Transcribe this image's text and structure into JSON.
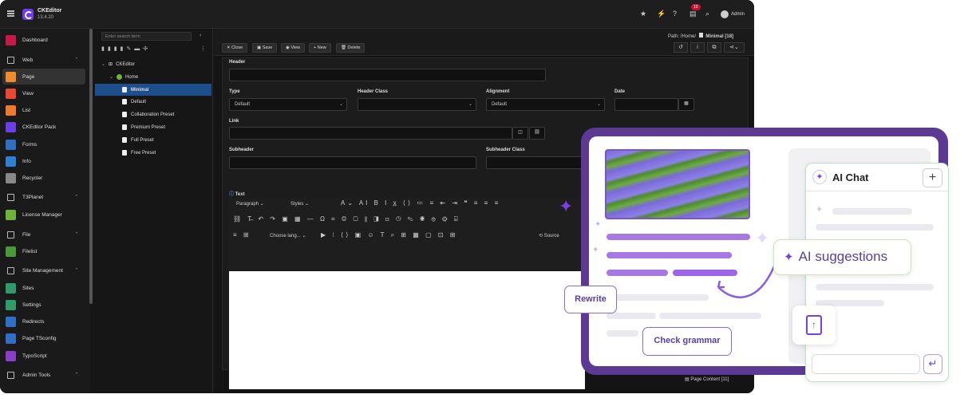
{
  "app": {
    "name": "CKEditor",
    "version": "13.4.20"
  },
  "topbar": {
    "notification_count": "10",
    "user_name": "Admin"
  },
  "module_menu": [
    {
      "label": "Dashboard",
      "color": "#c8174a",
      "type": "item"
    },
    {
      "label": "Web",
      "type": "group"
    },
    {
      "label": "Page",
      "color": "#f08c2c",
      "type": "item",
      "active": true
    },
    {
      "label": "View",
      "color": "#e84834",
      "type": "item"
    },
    {
      "label": "List",
      "color": "#f07a2c",
      "type": "item"
    },
    {
      "label": "CKEditor Pack",
      "color": "#6a3ee8",
      "type": "item"
    },
    {
      "label": "Forms",
      "color": "#2f6fc5",
      "type": "item"
    },
    {
      "label": "Info",
      "color": "#2f7fd5",
      "type": "item"
    },
    {
      "label": "Recycler",
      "color": "#888888",
      "type": "item"
    },
    {
      "label": "T3Planet",
      "type": "group"
    },
    {
      "label": "License Manager",
      "color": "#6fb23c",
      "type": "item"
    },
    {
      "label": "File",
      "type": "group"
    },
    {
      "label": "Filelist",
      "color": "#4a9a3a",
      "type": "item"
    },
    {
      "label": "Site Management",
      "type": "group"
    },
    {
      "label": "Sites",
      "color": "#2f9a6a",
      "type": "item"
    },
    {
      "label": "Settings",
      "color": "#2f9a6a",
      "type": "item"
    },
    {
      "label": "Redirects",
      "color": "#2f6fc5",
      "type": "item"
    },
    {
      "label": "Page TSconfig",
      "color": "#2f6fc5",
      "type": "item"
    },
    {
      "label": "TypoScript",
      "color": "#8a3ec5",
      "type": "item"
    },
    {
      "label": "Admin Tools",
      "type": "group"
    }
  ],
  "tree": {
    "search_placeholder": "Enter search term",
    "root": "CKEditor",
    "home": "Home",
    "pages": [
      "Minimal",
      "Default",
      "Collaboration Preset",
      "Premium Preset",
      "Full Preset",
      "Free Preset"
    ]
  },
  "docheader": {
    "buttons": [
      "Close",
      "Save",
      "View",
      "New",
      "Delete"
    ],
    "path_label": "Path: /Home/",
    "page_title": "Minimal [18]"
  },
  "form": {
    "header_label": "Header",
    "type_label": "Type",
    "type_value": "Default",
    "header_class_label": "Header Class",
    "alignment_label": "Alignment",
    "alignment_value": "Default",
    "date_label": "Date",
    "link_label": "Link",
    "subheader_label": "Subheader",
    "subheader_class_label": "Subheader Class",
    "text_label": "Text"
  },
  "ck_toolbar": {
    "paragraph": "Paragraph",
    "styles": "Styles",
    "choose_language": "Choose lang...",
    "source": "Source"
  },
  "footer": {
    "page_content": "Page Content [11]"
  },
  "promo": {
    "ai_chat_title": "AI Chat",
    "ai_suggestions": "AI suggestions",
    "rewrite": "Rewrite",
    "check_grammar": "Check grammar"
  }
}
